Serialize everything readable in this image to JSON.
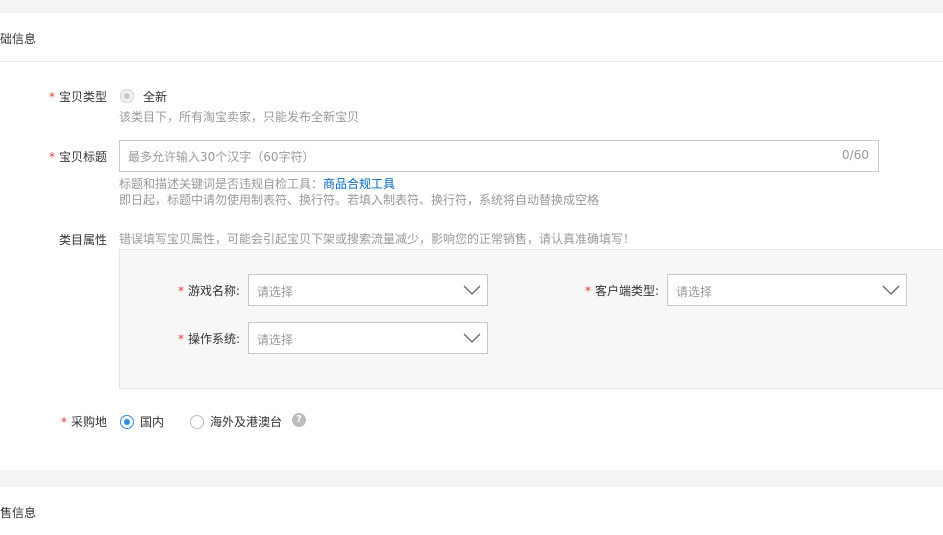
{
  "section_basic": {
    "title": "础信息"
  },
  "item_type": {
    "label": "宝贝类型",
    "required_mark": "*",
    "option": "全新",
    "hint": "该类目下，所有淘宝卖家，只能发布全新宝贝"
  },
  "item_title": {
    "label": "宝贝标题",
    "required_mark": "*",
    "placeholder": "最多允许输入30个汉字（60字符）",
    "counter": "0/60",
    "hint1_prefix": "标题和描述关键词是否违规自检工具：",
    "hint1_link": "商品合规工具",
    "hint2": "即日起，标题中请勿使用制表符、换行符。若填入制表符、换行符，系统将自动替换成空格"
  },
  "category_props": {
    "label": "类目属性",
    "warning": "错误填写宝贝属性，可能会引起宝贝下架或搜索流量减少，影响您的正常销售，请认真准确填写！",
    "fields": [
      {
        "label": "游戏名称:",
        "required_mark": "*",
        "placeholder": "请选择"
      },
      {
        "label": "客户端类型:",
        "required_mark": "*",
        "placeholder": "请选择"
      },
      {
        "label": "操作系统:",
        "required_mark": "*",
        "placeholder": "请选择"
      }
    ]
  },
  "purchase_location": {
    "label": "采购地",
    "required_mark": "*",
    "options": [
      {
        "label": "国内",
        "checked": true
      },
      {
        "label": "海外及港澳台",
        "checked": false
      }
    ],
    "help_icon": "?"
  },
  "section_sales": {
    "title": "售信息"
  },
  "colors": {
    "required": "#e4393c",
    "link": "#0066c0",
    "radio_checked": "#2a8ce8",
    "page_bg": "#f4f4f4",
    "panel_bg": "#ffffff"
  }
}
